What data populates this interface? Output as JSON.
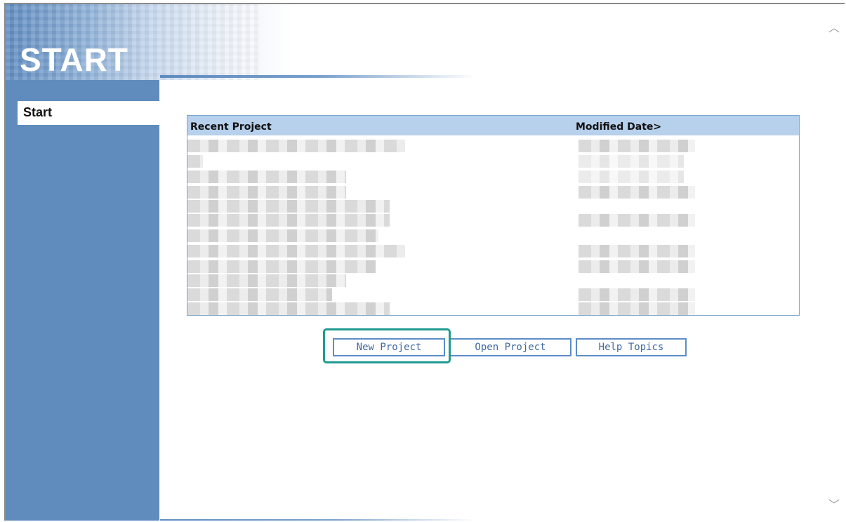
{
  "header": {
    "title": "START"
  },
  "sidebar": {
    "items": [
      {
        "label": "Start"
      }
    ]
  },
  "recent_projects": {
    "columns": {
      "project": "Recent Project",
      "date": "Modified Date>"
    }
  },
  "buttons": {
    "new_project": "New Project",
    "open_project": "Open Project",
    "help_topics": "Help Topics"
  },
  "icons": {
    "scroll_up": "chevron-up-icon",
    "scroll_down": "chevron-down-icon"
  },
  "colors": {
    "accent": "#5f8cbd",
    "table_header": "#b7d0ec",
    "highlight": "#1f9a91"
  }
}
